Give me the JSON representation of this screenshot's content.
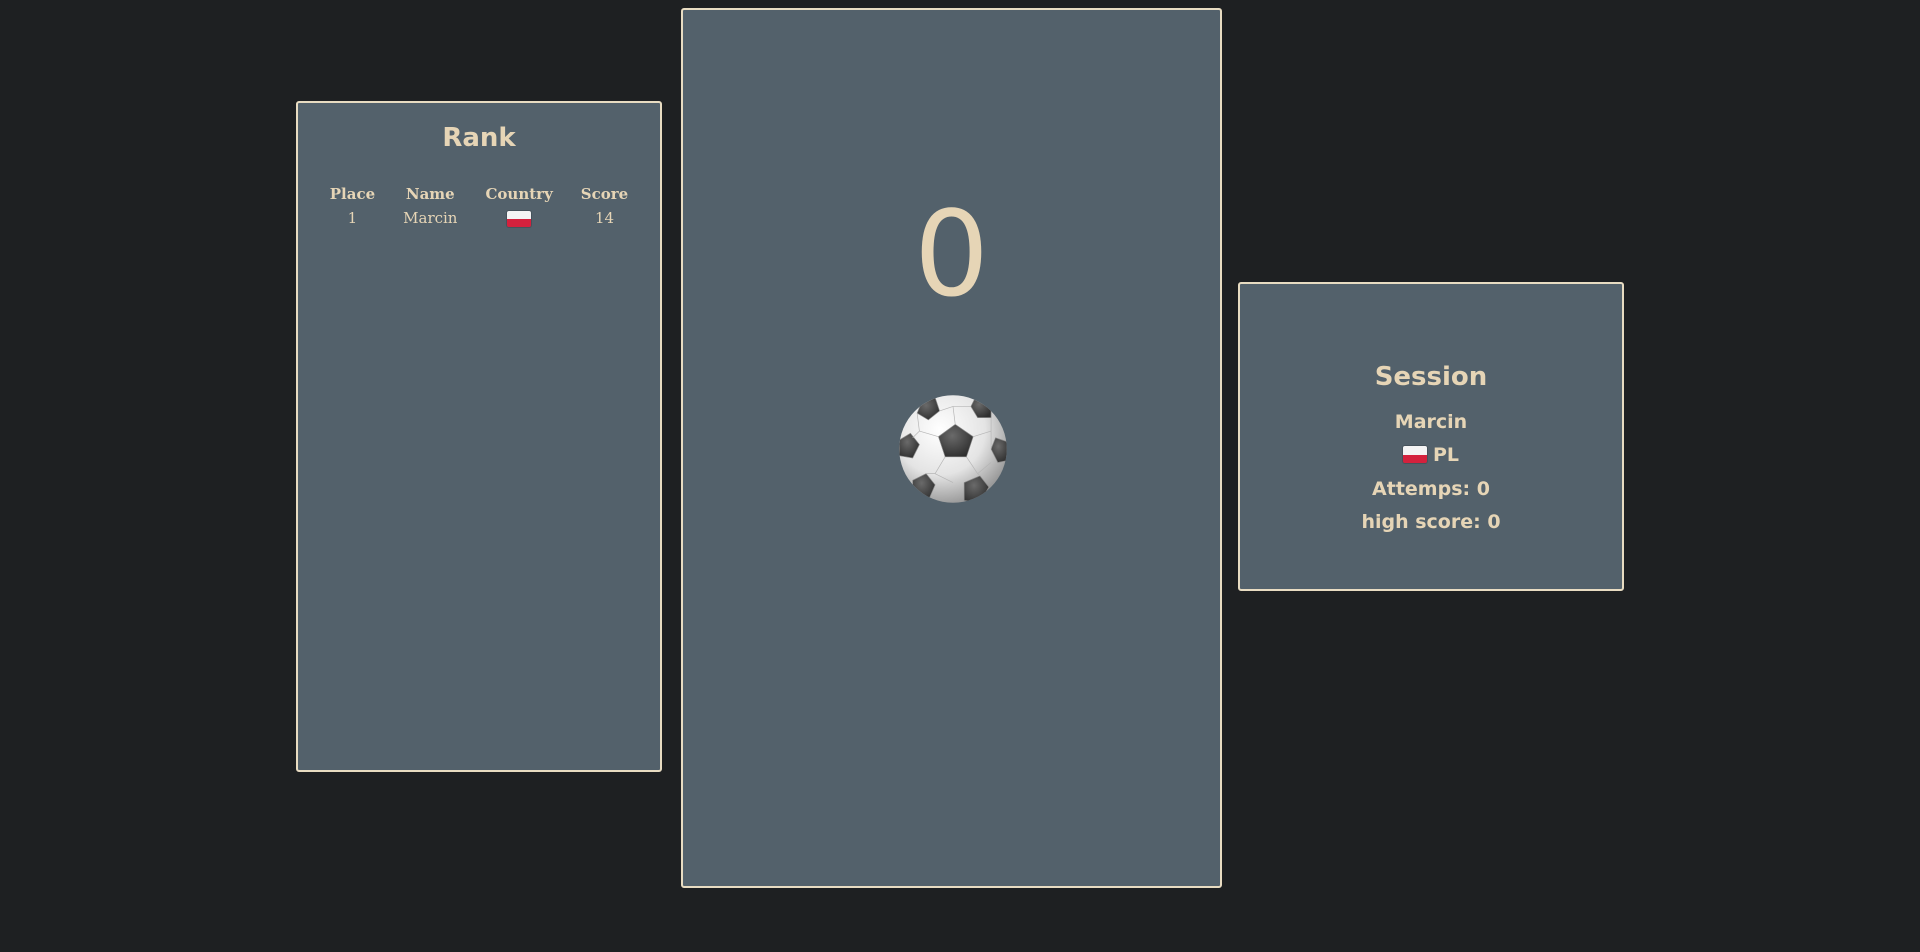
{
  "rank": {
    "title": "Rank",
    "headers": [
      "Place",
      "Name",
      "Country",
      "Score"
    ],
    "rows": [
      {
        "place": "1",
        "name": "Marcin",
        "country_flag": "poland-flag-icon",
        "score": "14"
      }
    ]
  },
  "game": {
    "score": "0",
    "ball_icon": "soccer-ball-icon"
  },
  "session": {
    "title": "Session",
    "name": "Marcin",
    "country_flag": "poland-flag-icon",
    "country_code": "PL",
    "attempts": "Attemps: 0",
    "high_score": "high score: 0"
  },
  "colors": {
    "background": "#1e2022",
    "panel": "#53616b",
    "border": "#e8dcc2",
    "text": "#e6d5b6",
    "flag_white": "#f4f4f4",
    "flag_red": "#d4213d"
  }
}
